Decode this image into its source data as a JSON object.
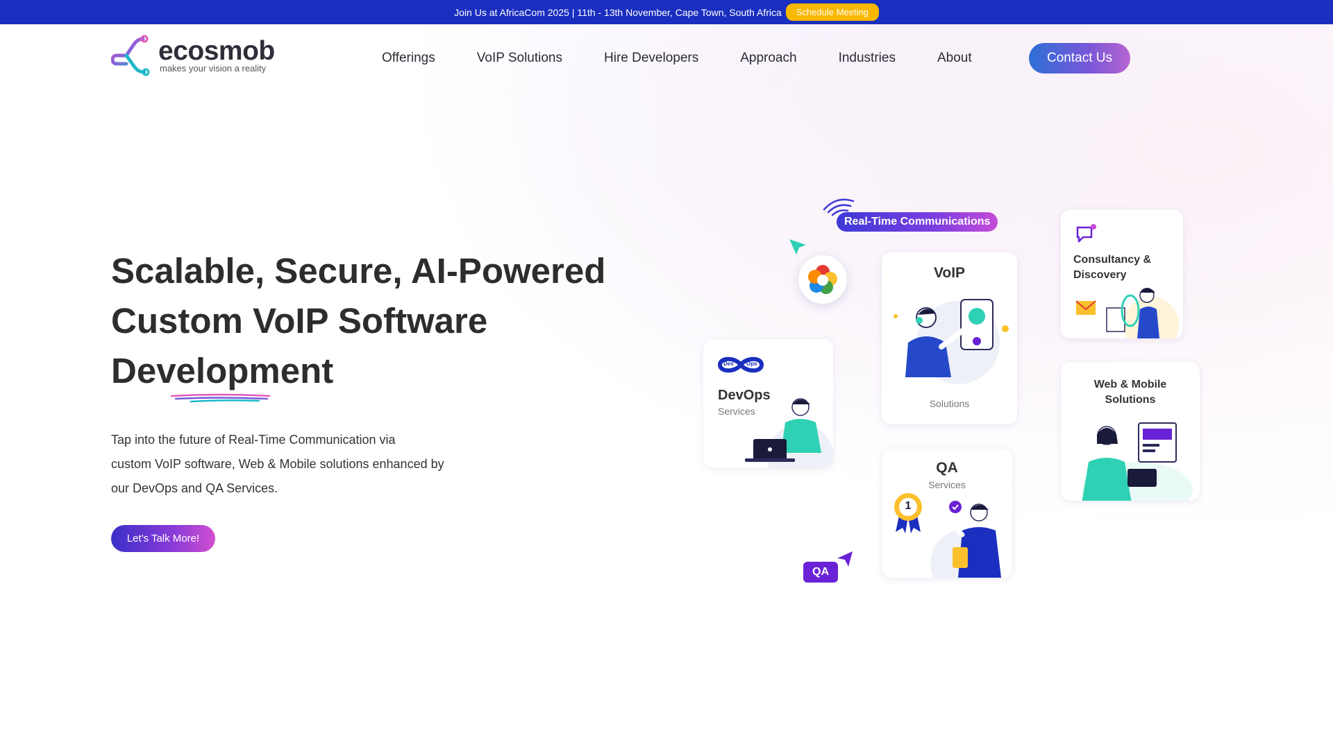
{
  "announcement": {
    "text": "Join Us at AfricaCom 2025 | 11th - 13th November, Cape Town, South Africa",
    "button_label": "Schedule Meeting"
  },
  "header": {
    "logo": {
      "brand": "ecosmob",
      "tagline": "makes your vision a reality"
    },
    "nav": [
      {
        "label": "Offerings"
      },
      {
        "label": "VoIP Solutions"
      },
      {
        "label": "Hire Developers"
      },
      {
        "label": "Approach"
      },
      {
        "label": "Industries"
      },
      {
        "label": "About"
      }
    ],
    "contact_label": "Contact Us"
  },
  "hero": {
    "title_line1": "Scalable, Secure, AI-Powered",
    "title_line2": "Custom VoIP Software",
    "title_line3": "Development",
    "subtitle_line1": "Tap into the future of Real-Time Communication via",
    "subtitle_line2": "custom VoIP software, Web & Mobile solutions enhanced by",
    "subtitle_line3": "our DevOps and QA Services.",
    "cta_label": "Let's Talk More!"
  },
  "illustration": {
    "rtc_label": "Real-Time Communications",
    "voip": {
      "title": "VoIP",
      "subtitle": "Solutions"
    },
    "devops": {
      "badge_left": "Dev",
      "badge_right": "Ops",
      "title": "DevOps",
      "subtitle": "Services"
    },
    "qa": {
      "title": "QA",
      "subtitle": "Services",
      "badge_number": "1"
    },
    "consultancy": {
      "title_line1": "Consultancy &",
      "title_line2": "Discovery"
    },
    "web_mobile": {
      "title_line1": "Web & Mobile",
      "title_line2": "Solutions"
    },
    "qa_pill": "QA"
  },
  "colors": {
    "announce_bg": "#1a2fbf",
    "meeting_button": "#f9b800",
    "accent_purple": "#6a22d6",
    "accent_teal": "#2fd1b4",
    "accent_blue": "#2d6fd6"
  }
}
